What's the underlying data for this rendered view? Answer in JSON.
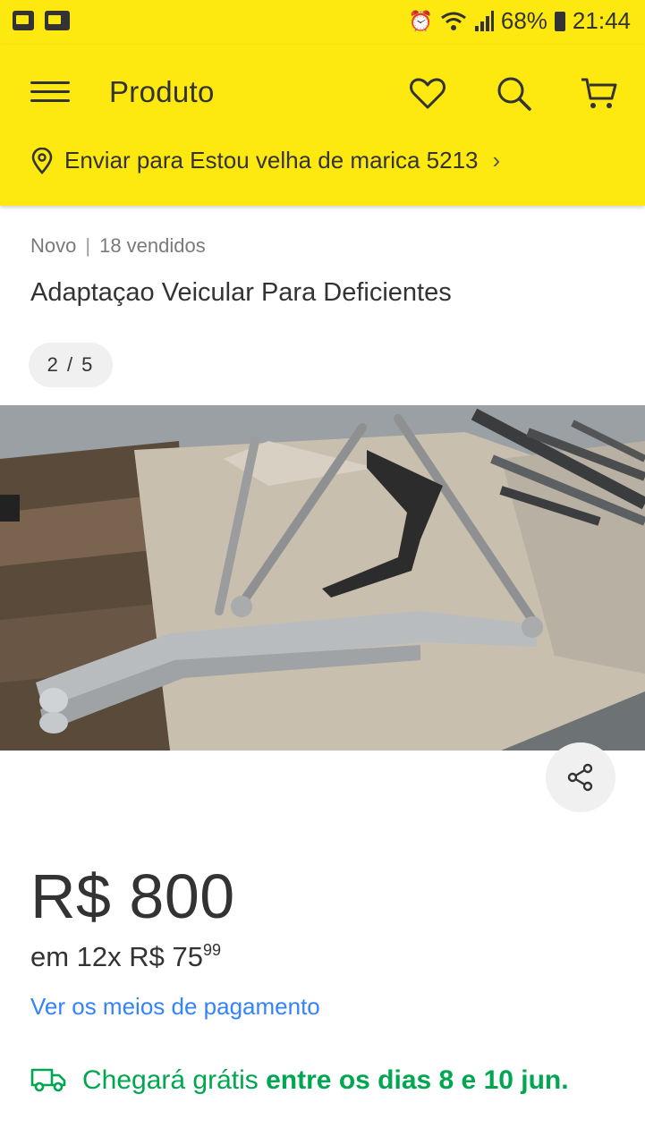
{
  "status_bar": {
    "battery": "68%",
    "time": "21:44"
  },
  "header": {
    "title": "Produto",
    "shipping_text": "Enviar para Estou velha de marica 5213"
  },
  "product": {
    "condition": "Novo",
    "sold": "18 vendidos",
    "title": "Adaptaçao Veicular Para Deficientes",
    "image_counter": "2 / 5",
    "price": "R$ 800",
    "installments_prefix": "em 12x R$ 75",
    "installments_cents": "99",
    "payment_link": "Ver os meios de pagamento",
    "delivery_prefix": "Chegará grátis",
    "delivery_bold": "entre os dias 8 e 10 jun."
  },
  "colors": {
    "brand_yellow": "#fde80f",
    "link_blue": "#3483fa",
    "green": "#00a650"
  },
  "icons": [
    "menu-icon",
    "heart-icon",
    "search-icon",
    "cart-icon",
    "location-pin-icon",
    "chevron-right-icon",
    "share-icon",
    "truck-icon"
  ]
}
